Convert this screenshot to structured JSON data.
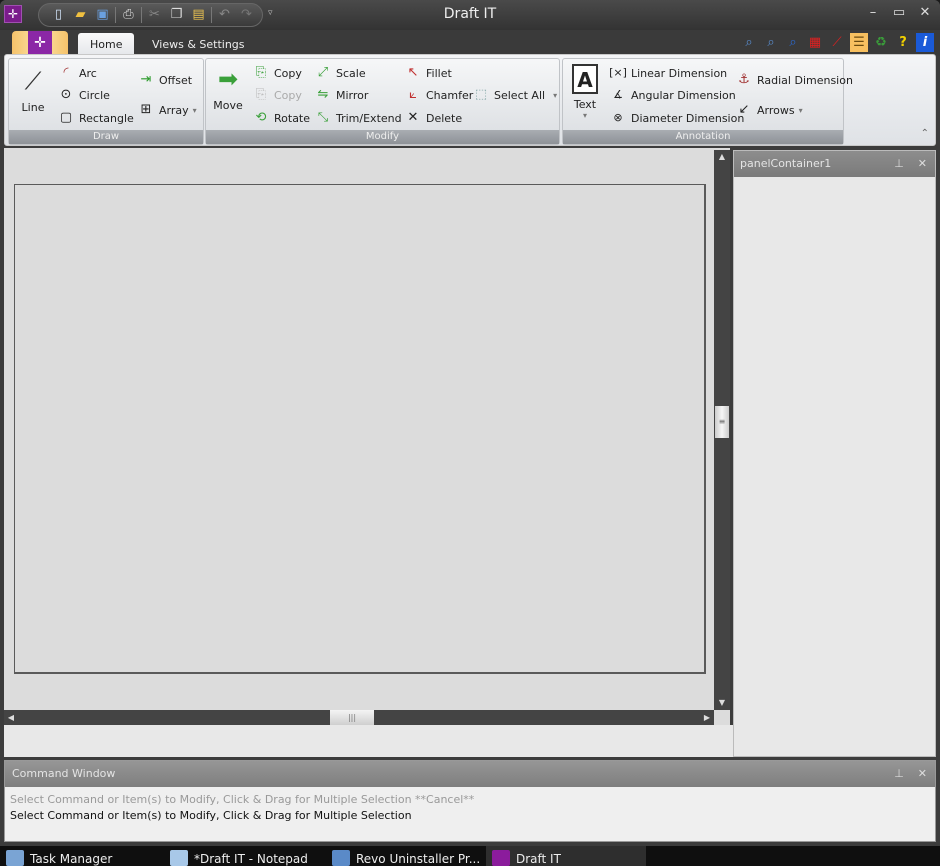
{
  "window": {
    "title": "Draft IT",
    "controls": {
      "minimize": "–",
      "maximize": "▭",
      "close": "✕"
    }
  },
  "quick_access": [
    {
      "name": "new-icon",
      "glyph": "📄"
    },
    {
      "name": "open-icon",
      "glyph": "📂"
    },
    {
      "name": "save-icon",
      "glyph": "💾"
    },
    {
      "name": "print-icon",
      "glyph": "🖨"
    },
    {
      "name": "cut-icon",
      "glyph": "✂"
    },
    {
      "name": "copy-icon",
      "glyph": "❐"
    },
    {
      "name": "paste-icon",
      "glyph": "📋"
    },
    {
      "name": "undo-icon",
      "glyph": "↶"
    },
    {
      "name": "redo-icon",
      "glyph": "↷"
    }
  ],
  "qat_more": "▿",
  "tabs": [
    {
      "label": "Home",
      "active": true
    },
    {
      "label": "Views & Settings",
      "active": false
    }
  ],
  "tool_icons": [
    {
      "name": "zoom-window-icon",
      "glyph": "🔍",
      "color": "#4a7cc4"
    },
    {
      "name": "zoom-extents-icon",
      "glyph": "🔎",
      "color": "#4a7cc4"
    },
    {
      "name": "zoom-pan-icon",
      "glyph": "🔍",
      "color": "#2a6ad4"
    },
    {
      "name": "grid-icon",
      "glyph": "▦",
      "color": "#d42020"
    },
    {
      "name": "snap-icon",
      "glyph": "⟋",
      "color": "#d42020"
    },
    {
      "name": "layers-icon",
      "glyph": "☰",
      "color": "#8a6a20"
    },
    {
      "name": "refresh-icon",
      "glyph": "♻",
      "color": "#3a9a3a"
    },
    {
      "name": "help-icon",
      "glyph": "?",
      "color": "#f0d000"
    },
    {
      "name": "info-icon",
      "glyph": "i",
      "color": "#ffffff"
    }
  ],
  "ribbon": {
    "draw": {
      "label": "Draw",
      "line": "Line",
      "arc": "Arc",
      "circle": "Circle",
      "rectangle": "Rectangle",
      "offset": "Offset",
      "array": "Array"
    },
    "modify": {
      "label": "Modify",
      "move": "Move",
      "copy": "Copy",
      "copy_disabled": "Copy",
      "rotate": "Rotate",
      "scale": "Scale",
      "mirror": "Mirror",
      "trim_extend": "Trim/Extend",
      "fillet": "Fillet",
      "chamfer": "Chamfer",
      "delete": "Delete",
      "select_all": "Select All"
    },
    "annotation": {
      "label": "Annotation",
      "text": "Text",
      "linear_dimension": "Linear Dimension",
      "angular_dimension": "Angular Dimension",
      "diameter_dimension": "Diameter Dimension",
      "radial_dimension": "Radial Dimension",
      "arrows": "Arrows"
    },
    "dropdown_glyph": "▾"
  },
  "panel": {
    "title": "panelContainer1",
    "pin": "⊥",
    "close": "✕"
  },
  "command_window": {
    "title": "Command Window",
    "pin": "⊥",
    "close": "✕",
    "history": "Select Command or Item(s) to Modify, Click & Drag for Multiple Selection  **Cancel**",
    "current": "Select Command or Item(s) to Modify, Click & Drag for Multiple Selection"
  },
  "scroll": {
    "up": "▲",
    "down": "▼",
    "left": "◀",
    "right": "▶",
    "v_grip": "≡",
    "h_grip": "|||"
  },
  "taskbar": [
    {
      "label": "Task Manager",
      "active": false
    },
    {
      "label": "*Draft IT - Notepad",
      "active": false
    },
    {
      "label": "Revo Uninstaller Pr...",
      "active": false
    },
    {
      "label": "Draft IT",
      "active": true
    }
  ],
  "colors": {
    "brand": "#8b27a6",
    "accent_tab": "#f5c26a"
  }
}
